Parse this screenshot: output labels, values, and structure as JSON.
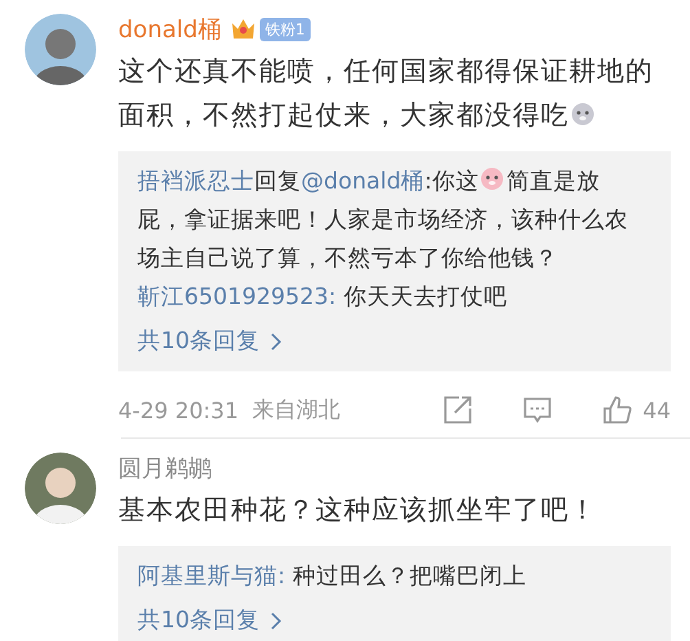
{
  "comments": [
    {
      "author": "donald桶",
      "vip": true,
      "badge": {
        "label": "铁粉1"
      },
      "body": [
        {
          "kind": "text",
          "text": "这个还真不能喷，任何国家都得保证耕地的面积，不然打起仗来，大家都没得吃"
        },
        {
          "kind": "emoji",
          "color": "#c9c9d2"
        }
      ],
      "replies": [
        [
          {
            "kind": "author",
            "text": "捂裆派忍士"
          },
          {
            "kind": "text",
            "text": "回复"
          },
          {
            "kind": "author",
            "text": "@donald桶"
          },
          {
            "kind": "text",
            "text": ":你这"
          },
          {
            "kind": "emoji",
            "color": "#f6b9c3"
          },
          {
            "kind": "text",
            "text": "简直是放屁，拿证据来吧！人家是市场经济，该种什么农场主自己说了算，不然亏本了你给他钱？"
          }
        ],
        [
          {
            "kind": "author",
            "text": "靳江6501929523:"
          },
          {
            "kind": "text",
            "text": " 你天天去打仗吧"
          }
        ]
      ],
      "more_replies": "共10条回复",
      "footer": {
        "time": "4-29 20:31",
        "location": "来自湖北",
        "likes": "44"
      }
    },
    {
      "author": "圆月鹈鹕",
      "vip": false,
      "body": [
        {
          "kind": "text",
          "text": "基本农田种花？这种应该抓坐牢了吧！"
        }
      ],
      "replies": [
        [
          {
            "kind": "author",
            "text": "阿基里斯与猫:"
          },
          {
            "kind": "text",
            "text": " 种过田么？把嘴巴闭上"
          }
        ]
      ],
      "more_replies": "共10条回复"
    }
  ]
}
